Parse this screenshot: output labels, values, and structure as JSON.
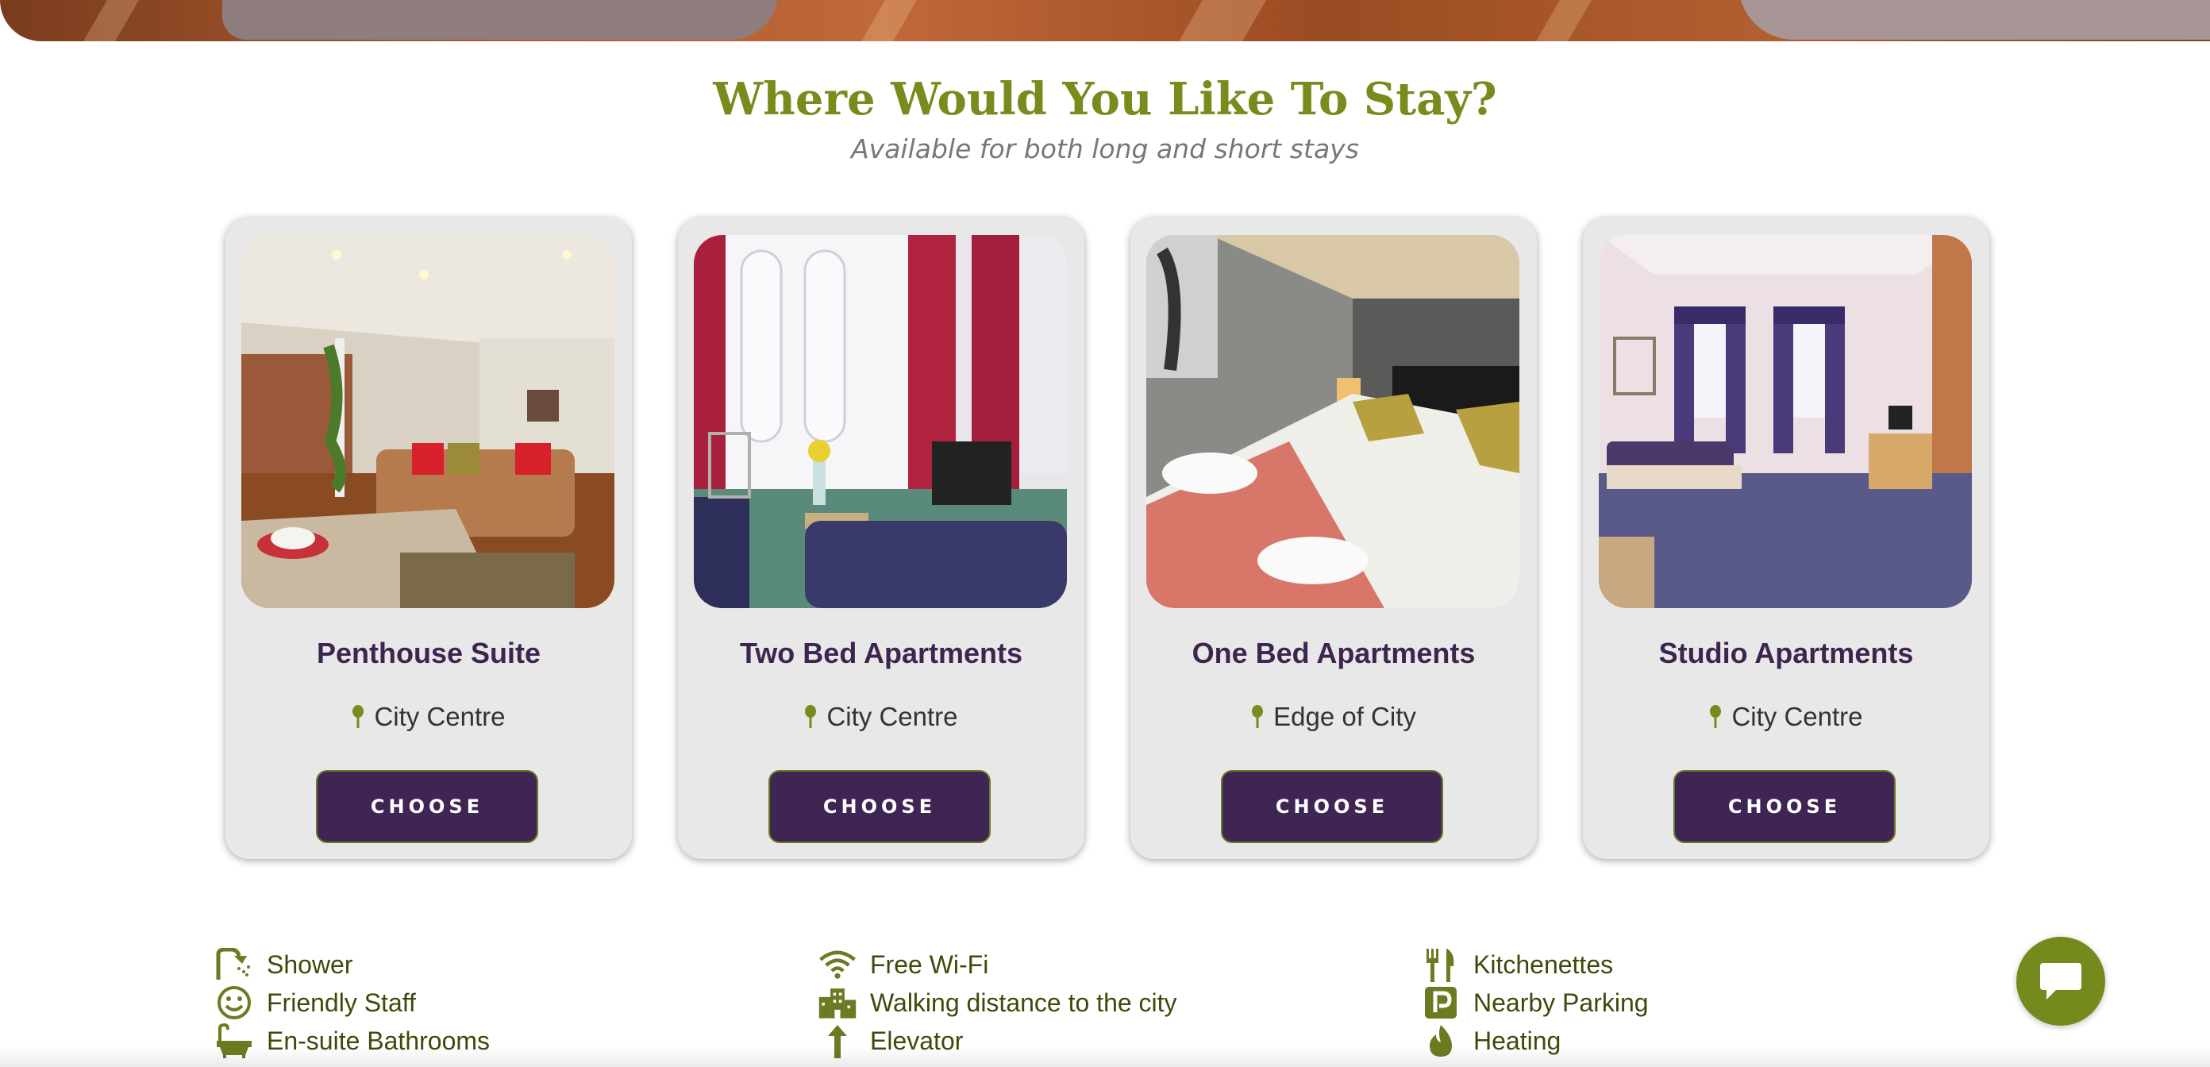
{
  "section": {
    "title": "Where Would You Like To Stay?",
    "subtitle": "Available for both long and short stays"
  },
  "cards": [
    {
      "name": "Penthouse Suite",
      "location": "City Centre",
      "button": "CHOOSE"
    },
    {
      "name": "Two Bed Apartments",
      "location": "City Centre",
      "button": "CHOOSE"
    },
    {
      "name": "One Bed Apartments",
      "location": "Edge of City",
      "button": "CHOOSE"
    },
    {
      "name": "Studio Apartments",
      "location": "City Centre",
      "button": "CHOOSE"
    }
  ],
  "amenities": {
    "col1": [
      {
        "label": "Shower",
        "icon": "shower-icon"
      },
      {
        "label": "Friendly Staff",
        "icon": "smiley-icon"
      },
      {
        "label": "En-suite Bathrooms",
        "icon": "bathtub-icon"
      }
    ],
    "col2": [
      {
        "label": "Free Wi-Fi",
        "icon": "wifi-icon"
      },
      {
        "label": "Walking distance to the city",
        "icon": "city-icon"
      },
      {
        "label": "Elevator",
        "icon": "elevator-arrow-icon"
      }
    ],
    "col3": [
      {
        "label": "Kitchenettes",
        "icon": "utensils-icon"
      },
      {
        "label": "Nearby Parking",
        "icon": "parking-icon"
      },
      {
        "label": "Heating",
        "icon": "flame-icon"
      }
    ]
  },
  "colors": {
    "accent_green": "#7a8a1c",
    "brand_purple": "#3f2553",
    "card_bg": "#e8e8e8"
  },
  "chat": {
    "icon": "chat-bubble-icon"
  }
}
